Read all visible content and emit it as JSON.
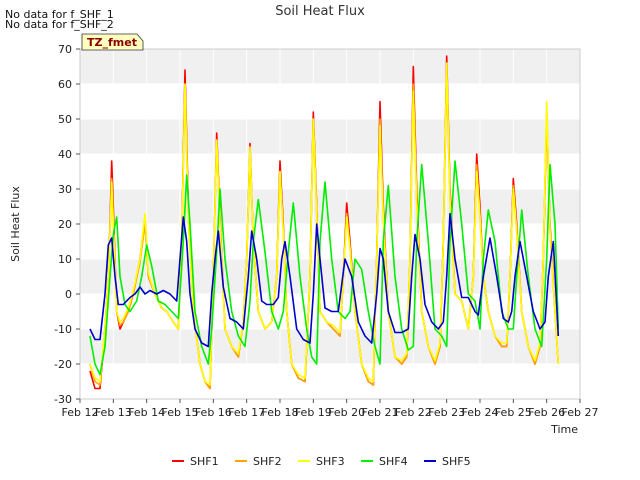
{
  "notes": [
    "No data for f_SHF_1",
    "No data for f_SHF_2"
  ],
  "tz_label": "TZ_fmet",
  "colors": {
    "SHF1": "#ff0000",
    "SHF2": "#ffa500",
    "SHF3": "#ffff00",
    "SHF4": "#00ee00",
    "SHF5": "#0000cc",
    "band": "#f0f0f0",
    "grid": "#ffffff",
    "tz_bg": "#ffffc0"
  },
  "chart_data": {
    "type": "line",
    "title": "Soil Heat Flux",
    "xlabel": "Time",
    "ylabel": "Soil Heat Flux",
    "xlim": [
      12,
      27
    ],
    "ylim": [
      -30,
      70
    ],
    "x_ticks": [
      12,
      13,
      14,
      15,
      16,
      17,
      18,
      19,
      20,
      21,
      22,
      23,
      24,
      25,
      26,
      27
    ],
    "x_tick_labels": [
      "Feb 12",
      "Feb 13",
      "Feb 14",
      "Feb 15",
      "Feb 16",
      "Feb 17",
      "Feb 18",
      "Feb 19",
      "Feb 20",
      "Feb 21",
      "Feb 22",
      "Feb 23",
      "Feb 24",
      "Feb 25",
      "Feb 26",
      "Feb 27"
    ],
    "y_ticks": [
      -30,
      -20,
      -10,
      0,
      10,
      20,
      30,
      40,
      50,
      60,
      70
    ],
    "grid": true,
    "legend_position": "bottom",
    "series": [
      {
        "name": "SHF1",
        "color": "#ff0000",
        "x": [
          12.3,
          12.45,
          12.6,
          12.75,
          12.85,
          12.9,
          12.95,
          13.0,
          13.05,
          13.1,
          13.2,
          13.3,
          13.45,
          13.6,
          13.8,
          13.95,
          14.05,
          14.25,
          14.45,
          14.6,
          14.8,
          14.95,
          15.05,
          15.15,
          15.25,
          15.4,
          15.6,
          15.75,
          15.9,
          16.0,
          16.1,
          16.2,
          16.35,
          16.55,
          16.75,
          16.9,
          17.0,
          17.1,
          17.2,
          17.35,
          17.55,
          17.75,
          17.9,
          18.0,
          18.1,
          18.2,
          18.35,
          18.55,
          18.75,
          18.9,
          19.0,
          19.1,
          19.2,
          19.4,
          19.6,
          19.8,
          19.9,
          20.0,
          20.1,
          20.25,
          20.45,
          20.65,
          20.8,
          20.9,
          21.0,
          21.1,
          21.25,
          21.45,
          21.65,
          21.8,
          21.9,
          22.0,
          22.1,
          22.25,
          22.45,
          22.65,
          22.8,
          22.9,
          23.0,
          23.1,
          23.25,
          23.45,
          23.65,
          23.8,
          23.9,
          24.0,
          24.1,
          24.25,
          24.45,
          24.65,
          24.8,
          24.9,
          25.0,
          25.1,
          25.25,
          25.45,
          25.65,
          25.8,
          25.9,
          26.0,
          26.1,
          26.25,
          26.35
        ],
        "values": [
          -22,
          -27,
          -27,
          -10,
          5,
          20,
          38,
          25,
          10,
          -5,
          -10,
          -8,
          -5,
          0,
          10,
          22,
          5,
          0,
          -4,
          -5,
          -8,
          -10,
          15,
          64,
          25,
          -5,
          -20,
          -25,
          -27,
          5,
          46,
          22,
          -10,
          -15,
          -18,
          -8,
          10,
          43,
          15,
          -5,
          -10,
          -8,
          5,
          38,
          20,
          -5,
          -20,
          -24,
          -25,
          5,
          52,
          25,
          -5,
          -8,
          -10,
          -12,
          5,
          26,
          15,
          -5,
          -20,
          -25,
          -26,
          10,
          55,
          25,
          -5,
          -18,
          -20,
          -18,
          10,
          65,
          30,
          -5,
          -15,
          -20,
          -15,
          15,
          68,
          30,
          0,
          -2,
          -10,
          5,
          40,
          25,
          5,
          -5,
          -12,
          -15,
          -15,
          5,
          33,
          20,
          -5,
          -15,
          -20,
          -15,
          10,
          52,
          20,
          -5,
          -20
        ]
      },
      {
        "name": "SHF2",
        "color": "#ffa500",
        "x": [
          12.3,
          12.45,
          12.6,
          12.75,
          12.85,
          12.9,
          12.95,
          13.0,
          13.05,
          13.1,
          13.2,
          13.3,
          13.45,
          13.6,
          13.8,
          13.95,
          14.05,
          14.25,
          14.45,
          14.6,
          14.8,
          14.95,
          15.05,
          15.15,
          15.25,
          15.4,
          15.6,
          15.75,
          15.9,
          16.0,
          16.1,
          16.2,
          16.35,
          16.55,
          16.75,
          16.9,
          17.0,
          17.1,
          17.2,
          17.35,
          17.55,
          17.75,
          17.9,
          18.0,
          18.1,
          18.2,
          18.35,
          18.55,
          18.75,
          18.9,
          19.0,
          19.1,
          19.2,
          19.4,
          19.6,
          19.8,
          19.9,
          20.0,
          20.1,
          20.25,
          20.45,
          20.65,
          20.8,
          20.9,
          21.0,
          21.1,
          21.25,
          21.45,
          21.65,
          21.8,
          21.9,
          22.0,
          22.1,
          22.25,
          22.45,
          22.65,
          22.8,
          22.9,
          23.0,
          23.1,
          23.25,
          23.45,
          23.65,
          23.8,
          23.9,
          24.0,
          24.1,
          24.25,
          24.45,
          24.65,
          24.8,
          24.9,
          25.0,
          25.1,
          25.25,
          25.45,
          25.65,
          25.8,
          25.9,
          26.0,
          26.1,
          26.25,
          26.35
        ],
        "values": [
          -20,
          -25,
          -26,
          -10,
          5,
          18,
          33,
          22,
          8,
          -5,
          -9,
          -8,
          -5,
          0,
          9,
          20,
          5,
          0,
          -4,
          -5,
          -8,
          -10,
          14,
          60,
          22,
          -5,
          -20,
          -25,
          -27,
          5,
          44,
          20,
          -10,
          -15,
          -18,
          -8,
          10,
          40,
          15,
          -5,
          -10,
          -8,
          5,
          35,
          18,
          -5,
          -20,
          -24,
          -25,
          5,
          50,
          23,
          -5,
          -8,
          -10,
          -12,
          5,
          23,
          13,
          -5,
          -20,
          -25,
          -26,
          10,
          50,
          22,
          -5,
          -18,
          -20,
          -18,
          10,
          60,
          27,
          -5,
          -15,
          -20,
          -15,
          15,
          62,
          27,
          0,
          -2,
          -10,
          5,
          37,
          22,
          5,
          -5,
          -12,
          -15,
          -15,
          5,
          31,
          18,
          -5,
          -15,
          -20,
          -15,
          10,
          50,
          18,
          -5,
          -20
        ]
      },
      {
        "name": "SHF3",
        "color": "#ffff00",
        "x": [
          12.3,
          12.45,
          12.6,
          12.75,
          12.85,
          12.9,
          12.95,
          13.0,
          13.05,
          13.1,
          13.2,
          13.3,
          13.45,
          13.6,
          13.8,
          13.95,
          14.05,
          14.25,
          14.45,
          14.6,
          14.8,
          14.95,
          15.05,
          15.15,
          15.25,
          15.4,
          15.6,
          15.75,
          15.9,
          16.0,
          16.1,
          16.2,
          16.35,
          16.55,
          16.75,
          16.9,
          17.0,
          17.1,
          17.2,
          17.35,
          17.55,
          17.75,
          17.9,
          18.0,
          18.1,
          18.2,
          18.35,
          18.55,
          18.75,
          18.9,
          19.0,
          19.1,
          19.2,
          19.4,
          19.6,
          19.8,
          19.9,
          20.0,
          20.1,
          20.25,
          20.45,
          20.65,
          20.8,
          20.9,
          21.0,
          21.1,
          21.25,
          21.45,
          21.65,
          21.8,
          21.9,
          22.0,
          22.1,
          22.25,
          22.45,
          22.65,
          22.8,
          22.9,
          23.0,
          23.1,
          23.25,
          23.45,
          23.65,
          23.8,
          23.9,
          24.0,
          24.1,
          24.25,
          24.45,
          24.65,
          24.8,
          24.9,
          25.0,
          25.1,
          25.25,
          25.45,
          25.65,
          25.8,
          25.9,
          26.0,
          26.1,
          26.25,
          26.35
        ],
        "values": [
          -20,
          -24,
          -25,
          -10,
          5,
          18,
          32,
          20,
          8,
          -5,
          -8,
          -7,
          -4,
          1,
          10,
          23,
          6,
          0,
          -4,
          -5,
          -8,
          -10,
          14,
          60,
          22,
          -5,
          -20,
          -25,
          -26,
          5,
          44,
          20,
          -10,
          -15,
          -17,
          -8,
          10,
          42,
          15,
          -5,
          -10,
          -8,
          5,
          35,
          18,
          -5,
          -20,
          -23,
          -24,
          5,
          50,
          23,
          -5,
          -8,
          -9,
          -11,
          5,
          22,
          13,
          -5,
          -20,
          -24,
          -25,
          10,
          48,
          22,
          -5,
          -18,
          -19,
          -17,
          10,
          58,
          26,
          -5,
          -15,
          -19,
          -14,
          15,
          66,
          27,
          0,
          -2,
          -10,
          5,
          35,
          22,
          5,
          -5,
          -12,
          -14,
          -14,
          5,
          30,
          18,
          -5,
          -15,
          -19,
          -14,
          10,
          55,
          18,
          -5,
          -20
        ]
      },
      {
        "name": "SHF4",
        "color": "#00ee00",
        "x": [
          12.3,
          12.45,
          12.6,
          12.75,
          12.9,
          13.0,
          13.1,
          13.2,
          13.35,
          13.5,
          13.7,
          13.85,
          14.0,
          14.15,
          14.35,
          14.55,
          14.75,
          14.95,
          15.1,
          15.2,
          15.3,
          15.45,
          15.65,
          15.85,
          15.95,
          16.1,
          16.2,
          16.35,
          16.55,
          16.75,
          16.95,
          17.1,
          17.2,
          17.35,
          17.55,
          17.75,
          17.95,
          18.1,
          18.25,
          18.4,
          18.6,
          18.8,
          18.95,
          19.1,
          19.2,
          19.35,
          19.55,
          19.75,
          19.95,
          20.1,
          20.25,
          20.45,
          20.65,
          20.85,
          21.0,
          21.1,
          21.25,
          21.45,
          21.65,
          21.85,
          22.0,
          22.1,
          22.25,
          22.45,
          22.65,
          22.85,
          23.0,
          23.1,
          23.25,
          23.45,
          23.65,
          23.85,
          24.0,
          24.1,
          24.25,
          24.45,
          24.65,
          24.85,
          25.0,
          25.1,
          25.25,
          25.45,
          25.65,
          25.85,
          26.0,
          26.1,
          26.25,
          26.35
        ],
        "values": [
          -12,
          -20,
          -23,
          -15,
          5,
          17,
          22,
          5,
          -3,
          -5,
          -2,
          5,
          14,
          8,
          -2,
          -3,
          -5,
          -7,
          15,
          34,
          20,
          -5,
          -15,
          -20,
          -10,
          12,
          30,
          10,
          -5,
          -12,
          -15,
          -2,
          15,
          27,
          12,
          -5,
          -10,
          -5,
          12,
          26,
          5,
          -10,
          -18,
          -20,
          15,
          32,
          10,
          -5,
          -7,
          -5,
          10,
          7,
          -5,
          -15,
          -20,
          15,
          31,
          5,
          -10,
          -16,
          -15,
          15,
          37,
          15,
          -10,
          -12,
          -15,
          15,
          38,
          20,
          0,
          -2,
          -10,
          10,
          24,
          15,
          -5,
          -10,
          -10,
          5,
          24,
          5,
          -10,
          -15,
          10,
          37,
          20,
          -10
        ]
      },
      {
        "name": "SHF5",
        "color": "#0000cc",
        "x": [
          12.3,
          12.45,
          12.6,
          12.75,
          12.85,
          12.95,
          13.05,
          13.15,
          13.3,
          13.5,
          13.65,
          13.8,
          13.95,
          14.1,
          14.3,
          14.5,
          14.7,
          14.9,
          15.0,
          15.1,
          15.2,
          15.3,
          15.45,
          15.65,
          15.85,
          15.95,
          16.05,
          16.15,
          16.3,
          16.5,
          16.7,
          16.9,
          17.05,
          17.15,
          17.3,
          17.45,
          17.6,
          17.8,
          17.95,
          18.05,
          18.15,
          18.3,
          18.5,
          18.7,
          18.9,
          19.0,
          19.1,
          19.2,
          19.35,
          19.55,
          19.75,
          19.95,
          20.15,
          20.35,
          20.55,
          20.75,
          20.9,
          21.0,
          21.1,
          21.25,
          21.45,
          21.65,
          21.85,
          21.95,
          22.05,
          22.2,
          22.35,
          22.55,
          22.75,
          22.9,
          23.0,
          23.1,
          23.25,
          23.45,
          23.65,
          23.85,
          23.95,
          24.1,
          24.3,
          24.5,
          24.7,
          24.85,
          24.95,
          25.05,
          25.2,
          25.4,
          25.6,
          25.8,
          25.95,
          26.05,
          26.2,
          26.35
        ],
        "values": [
          -10,
          -13,
          -13,
          0,
          14,
          16,
          5,
          -3,
          -3,
          -1,
          0,
          2,
          0,
          1,
          0,
          1,
          0,
          -2,
          10,
          22,
          15,
          0,
          -10,
          -14,
          -15,
          0,
          10,
          18,
          2,
          -7,
          -8,
          -10,
          5,
          18,
          10,
          -2,
          -3,
          -3,
          -1,
          10,
          15,
          5,
          -10,
          -13,
          -14,
          0,
          20,
          10,
          -4,
          -5,
          -5,
          10,
          5,
          -8,
          -12,
          -14,
          0,
          13,
          10,
          -5,
          -11,
          -11,
          -10,
          5,
          17,
          10,
          -3,
          -8,
          -10,
          -8,
          5,
          23,
          10,
          -1,
          -1,
          -5,
          -6,
          5,
          16,
          5,
          -7,
          -8,
          -5,
          5,
          15,
          5,
          -5,
          -10,
          -8,
          5,
          15,
          -12
        ]
      }
    ]
  }
}
